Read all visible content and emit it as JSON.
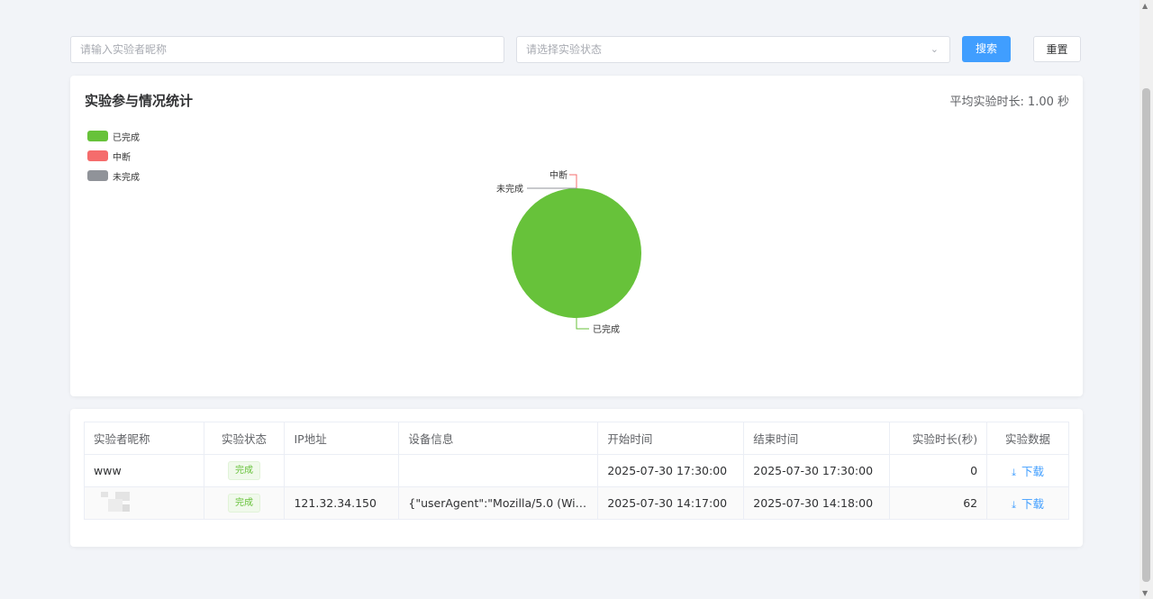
{
  "filters": {
    "name_placeholder": "请输入实验者昵称",
    "status_placeholder": "请选择实验状态",
    "search_label": "搜索",
    "reset_label": "重置"
  },
  "stats": {
    "title": "实验参与情况统计",
    "avg_label": "平均实验时长:",
    "avg_value": "1.00 秒"
  },
  "legend": [
    {
      "label": "已完成",
      "color": "#67c23a"
    },
    {
      "label": "中断",
      "color": "#f56c6c"
    },
    {
      "label": "未完成",
      "color": "#909399"
    }
  ],
  "chart_data": {
    "type": "pie",
    "slices": [
      {
        "label": "已完成",
        "value": 2,
        "color": "#67c23a"
      },
      {
        "label": "中断",
        "value": 0,
        "color": "#f56c6c"
      },
      {
        "label": "未完成",
        "value": 0,
        "color": "#909399"
      }
    ]
  },
  "table": {
    "columns": [
      "实验者昵称",
      "实验状态",
      "IP地址",
      "设备信息",
      "开始时间",
      "结束时间",
      "实验时长(秒)",
      "实验数据"
    ],
    "rows": [
      {
        "name": "www",
        "status": "完成",
        "ip": "",
        "device": "",
        "start": "2025-07-30 17:30:00",
        "end": "2025-07-30 17:30:00",
        "duration": "0",
        "action": "下载"
      },
      {
        "name": "",
        "status": "完成",
        "ip": "121.32.34.150",
        "device": "{\"userAgent\":\"Mozilla/5.0 (Wind...",
        "start": "2025-07-30 14:17:00",
        "end": "2025-07-30 14:18:00",
        "duration": "62",
        "action": "下载"
      }
    ]
  },
  "icons": {
    "dropdown": "chevron-down-icon",
    "download": "download-icon"
  }
}
